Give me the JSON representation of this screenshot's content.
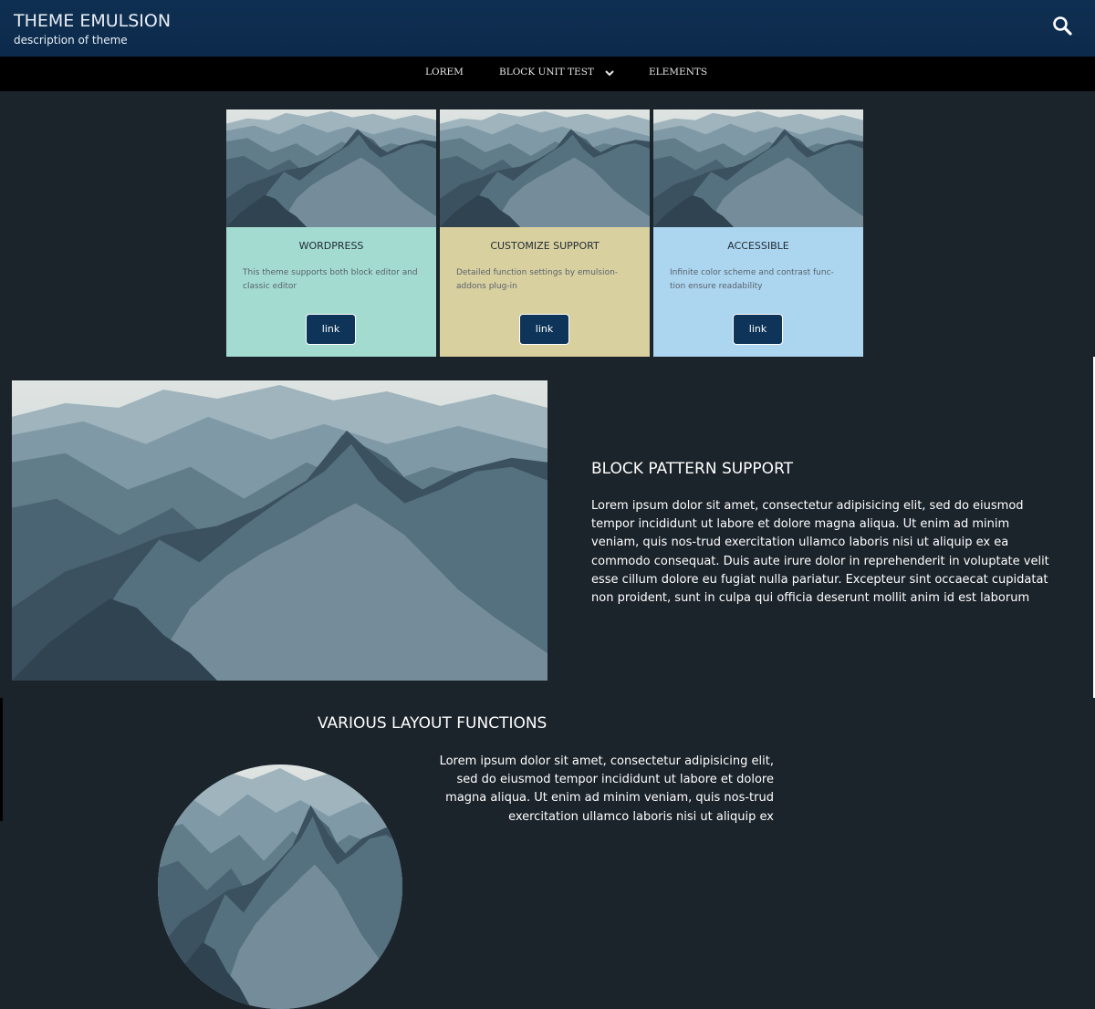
{
  "header": {
    "title": "THEME EMULSION",
    "description": "description of theme",
    "search_icon": "search-icon"
  },
  "nav": {
    "items": [
      "LOREM",
      "BLOCK UNIT TEST",
      "ELEMENTS"
    ],
    "dropdown_icon": "chevron-down-icon"
  },
  "cards": [
    {
      "title": "WORDPRESS",
      "text": "This theme supports both block editor and classic editor",
      "link": "link",
      "color": "#a3dbd0"
    },
    {
      "title": "CUSTOMIZE SUPPORT",
      "text": "Detailed function settings by emulsion-addons plug-in",
      "link": "link",
      "color": "#d9d0a0"
    },
    {
      "title": "ACCESSIBLE",
      "text": "Infinite color scheme and contrast func-tion ensure readability",
      "link": "link",
      "color": "#acd5f0"
    }
  ],
  "pattern": {
    "heading": "BLOCK PATTERN SUPPORT",
    "text": "Lorem ipsum dolor sit amet, consectetur adipisicing elit, sed do eiusmod tempor incididunt ut labore et dolore magna aliqua. Ut enim ad minim veniam, quis nos-trud exercitation ullamco laboris nisi ut aliquip ex ea commodo consequat. Duis aute irure dolor in reprehenderit in voluptate velit esse cillum dolore eu fugiat nulla pariatur. Excepteur sint occaecat cupidatat non proident, sunt in culpa qui officia deserunt mollit anim id est laborum"
  },
  "layout": {
    "heading": "VARIOUS LAYOUT FUNCTIONS",
    "text": "Lorem ipsum dolor sit amet, consectetur adipisicing elit, sed do eiusmod tempor incididunt ut labore et dolore magna aliqua. Ut enim ad minim veniam, quis nos-trud exercitation ullamco laboris nisi ut aliquip ex"
  },
  "colors": {
    "header_bg": "#0e2f51",
    "page_bg": "#1b232b",
    "button_bg": "#0e3459"
  }
}
